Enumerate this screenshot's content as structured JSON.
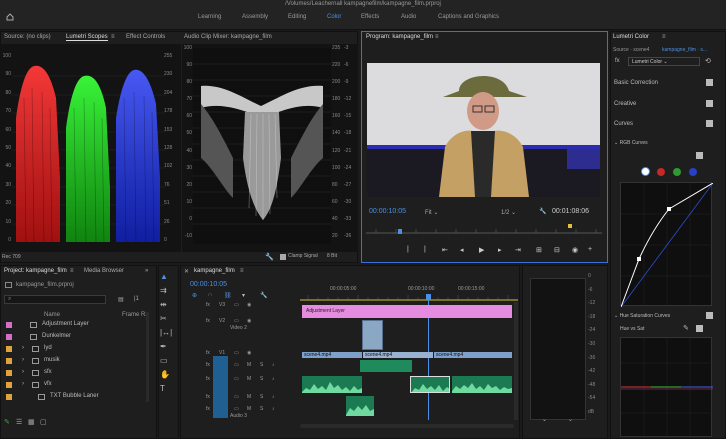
{
  "window": {
    "title": "/Volumes/Leachernall kampagnefilm/kampagne_film.prproj"
  },
  "workspaces": [
    {
      "label": "Learning",
      "active": false
    },
    {
      "label": "Assembly",
      "active": false
    },
    {
      "label": "Editing",
      "active": false
    },
    {
      "label": "Color",
      "active": true
    },
    {
      "label": "Effects",
      "active": false
    },
    {
      "label": "Audio",
      "active": false
    },
    {
      "label": "Captions and Graphics",
      "active": false
    }
  ],
  "scopes": {
    "tabs": [
      "Source: (no clips)",
      "Lumetri Scopes",
      "Effect Controls",
      "Audio Clip Mixer: kampagne_film"
    ],
    "left_scale": [
      "100",
      "90",
      "80",
      "70",
      "60",
      "50",
      "40",
      "30",
      "20",
      "10",
      "0"
    ],
    "right_scale_a": [
      "255",
      "230",
      "204",
      "178",
      "153",
      "128",
      "102",
      "76",
      "51",
      "26",
      "0"
    ],
    "right_scale_b": [
      "255",
      "230",
      "204",
      "178",
      "153",
      "128",
      "102",
      "76",
      "51",
      "26",
      "0"
    ],
    "wave_left": [
      "100",
      "90",
      "80",
      "70",
      "60",
      "50",
      "40",
      "30",
      "20",
      "10",
      "0",
      "-10"
    ],
    "wave_right_a": [
      "235",
      "220",
      "200",
      "180",
      "160",
      "140",
      "120",
      "100",
      "80",
      "60",
      "40",
      "20"
    ],
    "wave_right_b": [
      "-3",
      "-6",
      "-9",
      "-12",
      "-15",
      "-18",
      "-21",
      "-24",
      "-27",
      "-30",
      "-33",
      "-36"
    ],
    "clamp_label": "Clamp Signal",
    "bit_label": "8 Bit",
    "footer_left": "Rec 709"
  },
  "program": {
    "tab": "Program: kampagne_film",
    "timecode": "00:00:10:05",
    "fit": "Fit",
    "quality": "1/2",
    "duration": "00:01:08:06"
  },
  "lumetri": {
    "tab": "Lumetri Color",
    "source": "Source · scene4",
    "target": "kampagne_film · s...",
    "effect": "Lumetri Color",
    "fx_label": "fx",
    "sections": [
      "Basic Correction",
      "Creative",
      "Curves"
    ],
    "rgb_curves": "RGB Curves",
    "hue_sat": "Hue Saturation Curves",
    "hue_vs_sat": "Hue vs Sat",
    "curve_colors": [
      "#ffffff",
      "#d23030",
      "#3aa83a",
      "#3050d0"
    ]
  },
  "project": {
    "tabs": [
      "Project: kampagne_film",
      "Media Browser"
    ],
    "path": "kampagne_film.prproj",
    "columns": [
      "Name",
      "Frame Ra"
    ],
    "items": [
      {
        "name": "Adjustment Layer",
        "color": "#d36fc6",
        "indent": 1,
        "kind": "clip"
      },
      {
        "name": "Dunkelmer",
        "color": "#d36fc6",
        "indent": 1,
        "kind": "clip"
      },
      {
        "name": "lyd",
        "color": "#e0a23a",
        "indent": 0,
        "kind": "folder"
      },
      {
        "name": "musik",
        "color": "#e0a23a",
        "indent": 0,
        "kind": "folder"
      },
      {
        "name": "sfx",
        "color": "#e0a23a",
        "indent": 0,
        "kind": "folder"
      },
      {
        "name": "vfx",
        "color": "#e0a23a",
        "indent": 0,
        "kind": "folder"
      },
      {
        "name": "TXT Bubble Laner",
        "color": "#e0a23a",
        "indent": 2,
        "kind": "clip"
      }
    ]
  },
  "timeline": {
    "tab": "kampagne_film",
    "timecode": "00:00:10:05",
    "ruler": [
      "00:00:05:00",
      "00:00:10:00",
      "00:00:15:00"
    ],
    "tracks": [
      {
        "id": "V3",
        "name": ""
      },
      {
        "id": "V2",
        "name": "Video 2"
      },
      {
        "id": "V1",
        "name": ""
      },
      {
        "id": "A1",
        "name": ""
      },
      {
        "id": "A2",
        "name": ""
      },
      {
        "id": "A3",
        "name": ""
      },
      {
        "id": "A4",
        "name": "Audio 3"
      }
    ],
    "clips": {
      "adjustment": "Adjustment Layer",
      "v1_a": "scene4.mp4",
      "v1_b": "scene4.mp4",
      "v1_c": "scene4.mp4"
    }
  },
  "meter": {
    "scale": [
      "0",
      "-6",
      "-12",
      "-18",
      "-24",
      "-30",
      "-36",
      "-42",
      "-48",
      "-54",
      "dB"
    ]
  }
}
